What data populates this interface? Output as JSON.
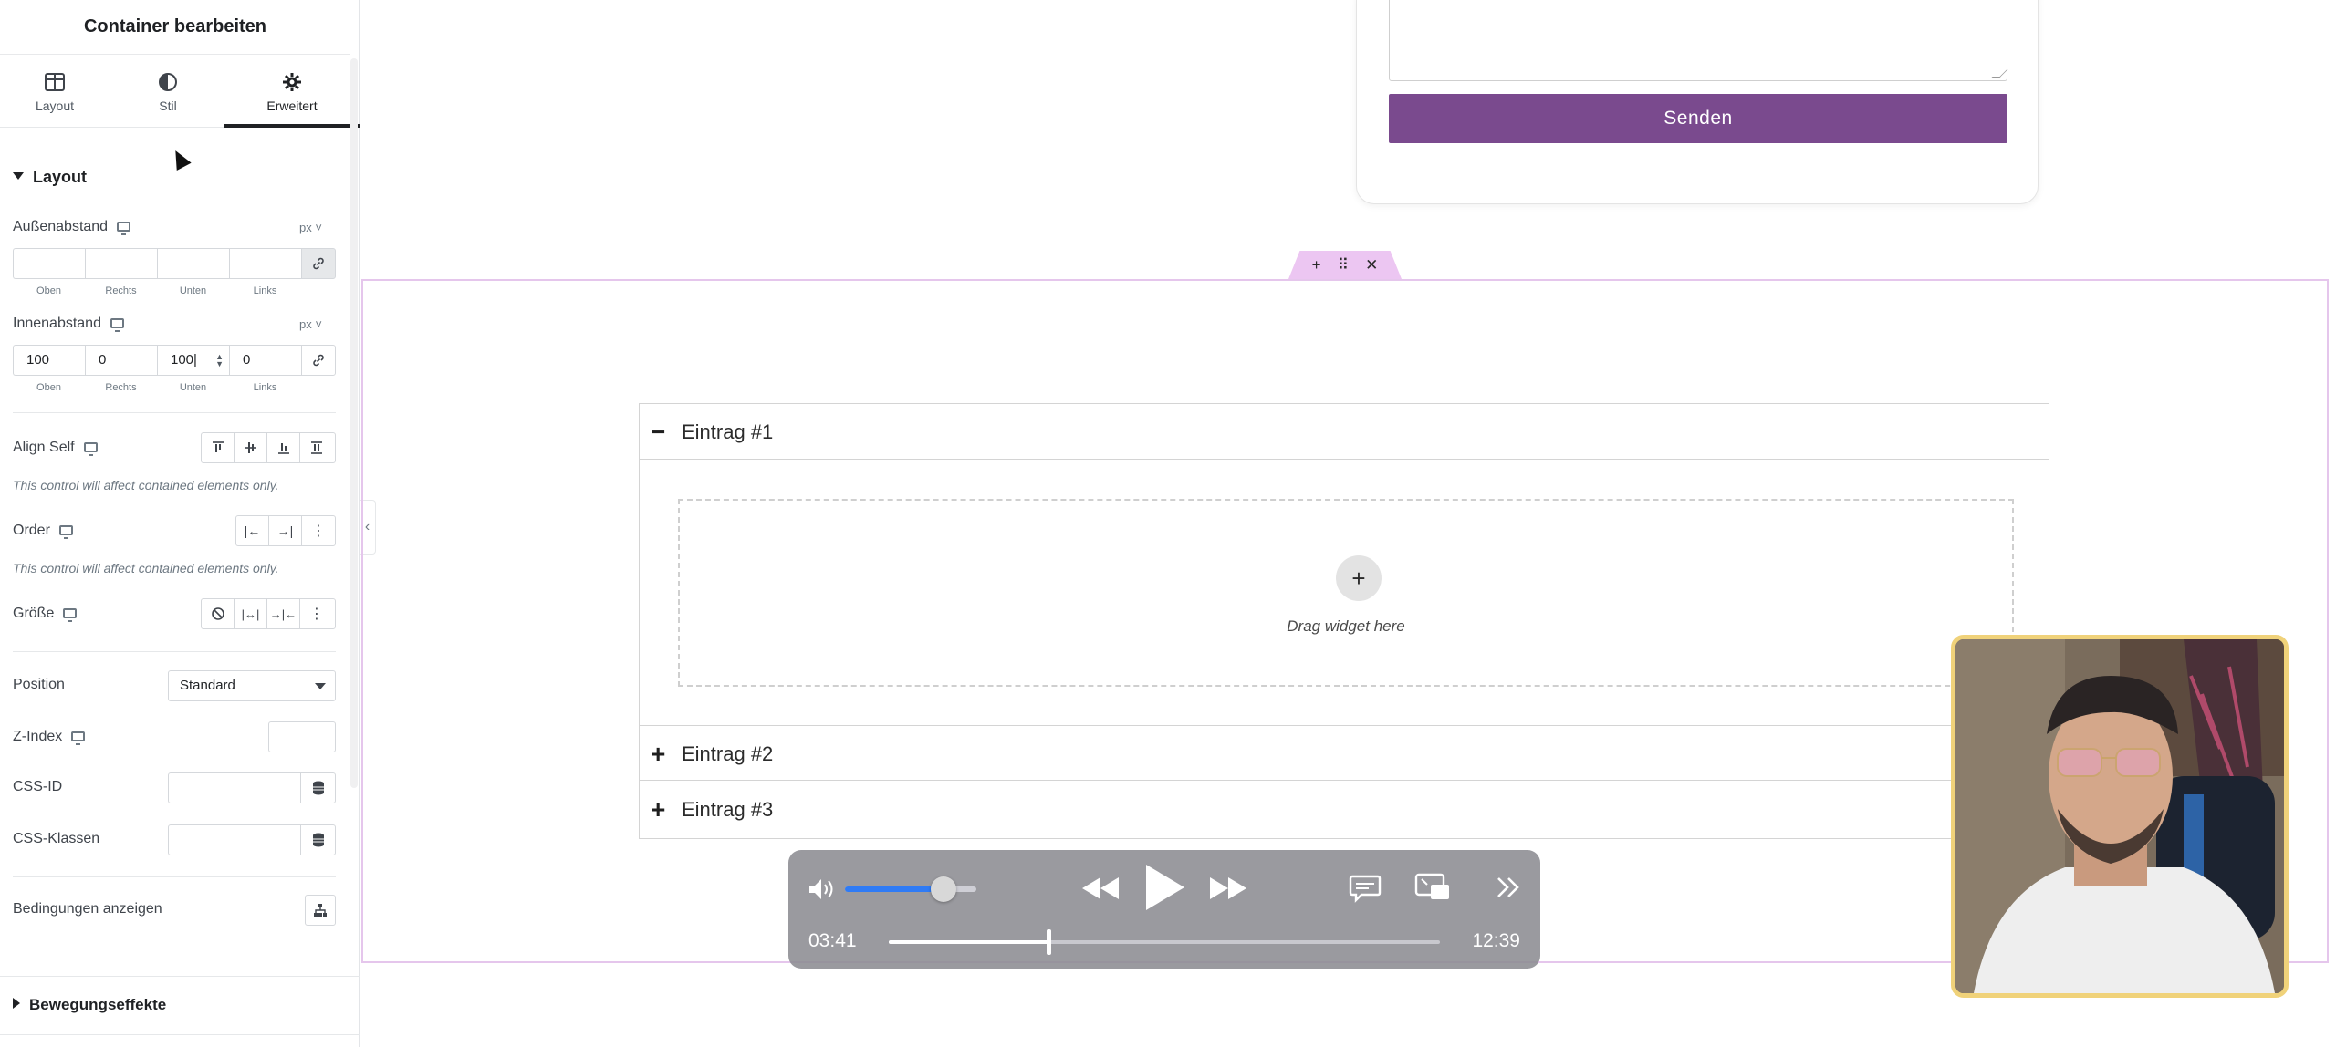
{
  "panel": {
    "title": "Container bearbeiten",
    "tabs": [
      {
        "label": "Layout",
        "icon": "layout-icon"
      },
      {
        "label": "Stil",
        "icon": "contrast-icon"
      },
      {
        "label": "Erweitert",
        "icon": "gear-icon",
        "active": true
      }
    ],
    "layout_section": {
      "title": "Layout",
      "margin": {
        "label": "Außenabstand",
        "unit": "px",
        "values": [
          "",
          "",
          "",
          ""
        ],
        "sides": [
          "Oben",
          "Rechts",
          "Unten",
          "Links"
        ]
      },
      "padding": {
        "label": "Innenabstand",
        "unit": "px",
        "values": [
          "100",
          "0",
          "100",
          "0"
        ],
        "sides": [
          "Oben",
          "Rechts",
          "Unten",
          "Links"
        ]
      },
      "align_self": {
        "label": "Align Self",
        "note": "This control will affect contained elements only."
      },
      "order": {
        "label": "Order",
        "note": "This control will affect contained elements only."
      },
      "size": {
        "label": "Größe"
      },
      "position": {
        "label": "Position",
        "value": "Standard"
      },
      "z_index": {
        "label": "Z-Index",
        "value": ""
      },
      "css_id": {
        "label": "CSS-ID",
        "value": ""
      },
      "css_classes": {
        "label": "CSS-Klassen",
        "value": ""
      },
      "conditions": {
        "label": "Bedingungen anzeigen"
      }
    },
    "motion_section": {
      "title": "Bewegungseffekte"
    }
  },
  "canvas": {
    "form": {
      "send_label": "Senden",
      "button_color": "#7a4a8e"
    },
    "accordion": {
      "items": [
        {
          "label": "Eintrag #1",
          "expanded": true
        },
        {
          "label": "Eintrag #2",
          "expanded": false
        },
        {
          "label": "Eintrag #3",
          "expanded": false
        }
      ],
      "drop_text": "Drag widget here"
    }
  },
  "player": {
    "current_time": "03:41",
    "total_time": "12:39",
    "progress_fraction": 0.29,
    "volume_fraction": 0.75
  },
  "colors": {
    "accent_purple": "#7a4a8e",
    "container_outline": "#e5c6ec",
    "volume_blue": "#2f7bf5"
  }
}
